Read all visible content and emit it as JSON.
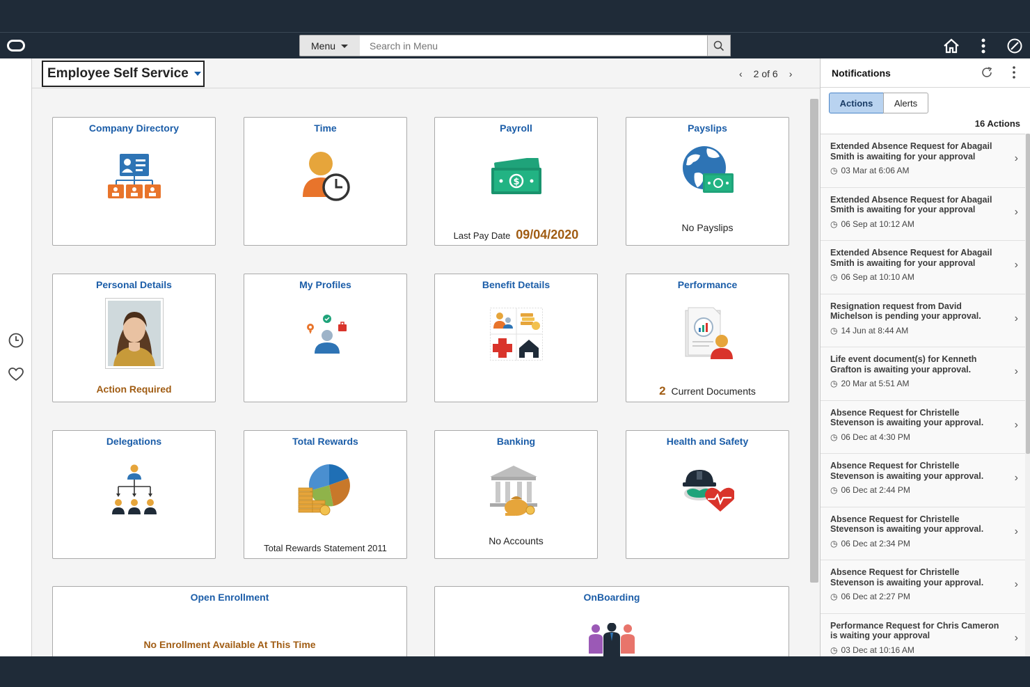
{
  "header": {
    "menu_label": "Menu",
    "search_placeholder": "Search in Menu"
  },
  "titlebar": {
    "homepage": "Employee Self Service",
    "pager": "2 of 6"
  },
  "tiles": [
    {
      "title": "Company Directory",
      "icon": "org-directory-icon"
    },
    {
      "title": "Time",
      "icon": "person-clock-icon"
    },
    {
      "title": "Payroll",
      "icon": "money-bills-icon",
      "foot_label": "Last Pay Date",
      "foot_value": "09/04/2020"
    },
    {
      "title": "Payslips",
      "icon": "globe-money-icon",
      "foot_label": "No Payslips"
    },
    {
      "title": "Personal Details",
      "icon": "portrait-photo",
      "foot_label": "Action Required"
    },
    {
      "title": "My Profiles",
      "icon": "profile-badges-icon"
    },
    {
      "title": "Benefit Details",
      "icon": "benefits-grid-icon"
    },
    {
      "title": "Performance",
      "icon": "performance-report-icon",
      "foot_value": "2",
      "foot_label": "Current Documents"
    },
    {
      "title": "Delegations",
      "icon": "delegation-tree-icon"
    },
    {
      "title": "Total Rewards",
      "icon": "pie-coins-icon",
      "foot_label": "Total Rewards Statement 2011"
    },
    {
      "title": "Banking",
      "icon": "bank-building-icon",
      "foot_label": "No Accounts"
    },
    {
      "title": "Health and Safety",
      "icon": "hardhat-heart-icon"
    },
    {
      "title": "Open Enrollment",
      "foot_label": "No Enrollment Available At This Time"
    },
    {
      "title": "OnBoarding",
      "icon": "people-group-icon"
    }
  ],
  "notifications": {
    "title": "Notifications",
    "tabs": [
      "Actions",
      "Alerts"
    ],
    "count": "16 Actions",
    "items": [
      {
        "text": "Extended Absence Request for Abagail Smith is awaiting for your approval",
        "time": "03 Mar at 6:06 AM"
      },
      {
        "text": "Extended Absence Request for Abagail Smith is awaiting for your approval",
        "time": "06 Sep at 10:12 AM"
      },
      {
        "text": "Extended Absence Request for Abagail Smith is awaiting for your approval",
        "time": "06 Sep at 10:10 AM"
      },
      {
        "text": "Resignation request from David Michelson is pending your approval.",
        "time": "14 Jun at 8:44 AM"
      },
      {
        "text": "Life event document(s) for Kenneth Grafton is awaiting your approval.",
        "time": "20 Mar at 5:51 AM"
      },
      {
        "text": "Absence Request for Christelle Stevenson is awaiting your approval.",
        "time": "06 Dec at 4:30 PM"
      },
      {
        "text": "Absence Request for Christelle Stevenson is awaiting your approval.",
        "time": "06 Dec at 2:44 PM"
      },
      {
        "text": "Absence Request for Christelle Stevenson is awaiting your approval.",
        "time": "06 Dec at 2:34 PM"
      },
      {
        "text": "Absence Request for Christelle Stevenson is awaiting your approval.",
        "time": "06 Dec at 2:27 PM"
      },
      {
        "text": "Performance Request for Chris Cameron is waiting your approval",
        "time": "03 Dec at 10:16 AM"
      }
    ]
  },
  "colors": {
    "header_bg": "#1f2b38",
    "tile_title": "#1b5da8",
    "warning": "#a05c13",
    "orange_icon": "#e8742b",
    "blue_icon": "#2e74b5",
    "green_money": "#1fa37a"
  }
}
